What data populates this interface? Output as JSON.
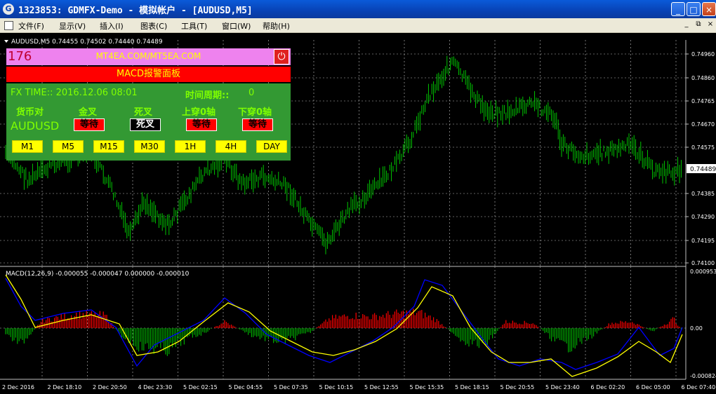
{
  "window": {
    "title": "1323853: GDMFX-Demo - 模拟帐户 - [AUDUSD,M5]",
    "app_icon": "G",
    "buttons": [
      "_",
      "□",
      "×"
    ]
  },
  "menu": {
    "items": [
      "文件(F)",
      "显示(V)",
      "插入(I)",
      "图表(C)",
      "工具(T)",
      "窗口(W)",
      "帮助(H)"
    ],
    "mdi_buttons": [
      "_",
      "⧉",
      "×"
    ]
  },
  "chart": {
    "header": "AUDUSD,M5  0.74455 0.74502 0.74440 0.74489",
    "price_ticks": [
      "0.74960",
      "0.74860",
      "0.74765",
      "0.74670",
      "0.74575",
      "0.74385",
      "0.74290",
      "0.74195",
      "0.74100"
    ],
    "current_price": "0.74489",
    "colors": {
      "bull": "#00ff00",
      "grid": "#c0c0c0",
      "macd_pos": "#ff0000",
      "macd_neg": "#00aa00",
      "main_line": "#0000ff",
      "signal_line": "#ffff00"
    }
  },
  "macd": {
    "header": "MACD(12,26,9) -0.000055 -0.000047 0.000000 -0.000010",
    "ticks": [
      "0.000953",
      "0.00",
      "-0.000824"
    ]
  },
  "time_labels": [
    "2 Dec 2016",
    "2 Dec 18:10",
    "2 Dec 20:50",
    "4 Dec 23:30",
    "5 Dec 02:15",
    "5 Dec 04:55",
    "5 Dec 07:35",
    "5 Dec 10:15",
    "5 Dec 12:55",
    "5 Dec 15:35",
    "5 Dec 18:15",
    "5 Dec 20:55",
    "5 Dec 23:40",
    "6 Dec 02:20",
    "6 Dec 05:00",
    "6 Dec 07:40"
  ],
  "panel": {
    "counter": "176",
    "site": "MT4EA.COM/MT5EA.COM",
    "power_icon": "⏻",
    "title": "MACD报警面板",
    "time_label": "FX TIME:: 2016.12.06 08:01",
    "timeframe_label": "时间周期::",
    "timeframe_value": "0",
    "headers": [
      "货币对",
      "金叉",
      "死叉",
      "上穿0轴",
      "下穿0轴"
    ],
    "symbol": "AUDUSD",
    "statuses": [
      "等待",
      "死叉",
      "等待",
      "等待"
    ],
    "tf_buttons": [
      "M1",
      "M5",
      "M15",
      "M30",
      "1H",
      "4H",
      "DAY"
    ]
  }
}
